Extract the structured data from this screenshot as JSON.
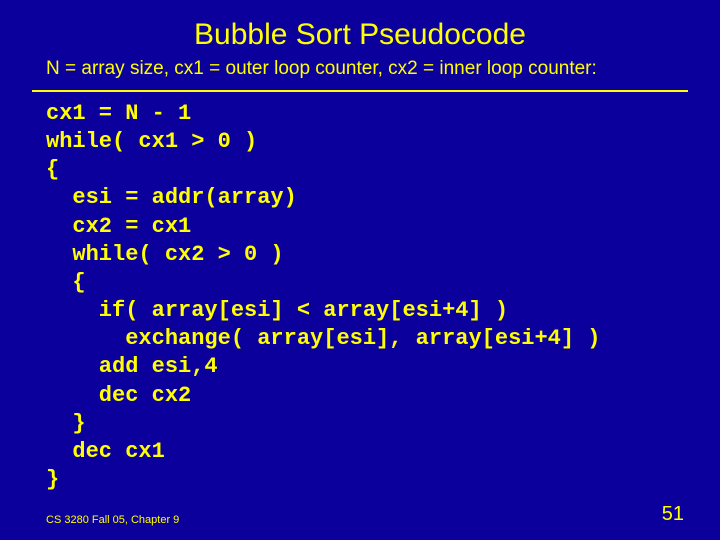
{
  "title": "Bubble Sort Pseudocode",
  "subtitle": "N = array size, cx1 = outer loop counter, cx2 = inner loop counter:",
  "code": "cx1 = N - 1\nwhile( cx1 > 0 )\n{\n  esi = addr(array)\n  cx2 = cx1\n  while( cx2 > 0 )\n  {\n    if( array[esi] < array[esi+4] )\n      exchange( array[esi], array[esi+4] )\n    add esi,4\n    dec cx2\n  }\n  dec cx1\n}",
  "footer": "CS 3280 Fall 05, Chapter 9",
  "page_number": "51"
}
